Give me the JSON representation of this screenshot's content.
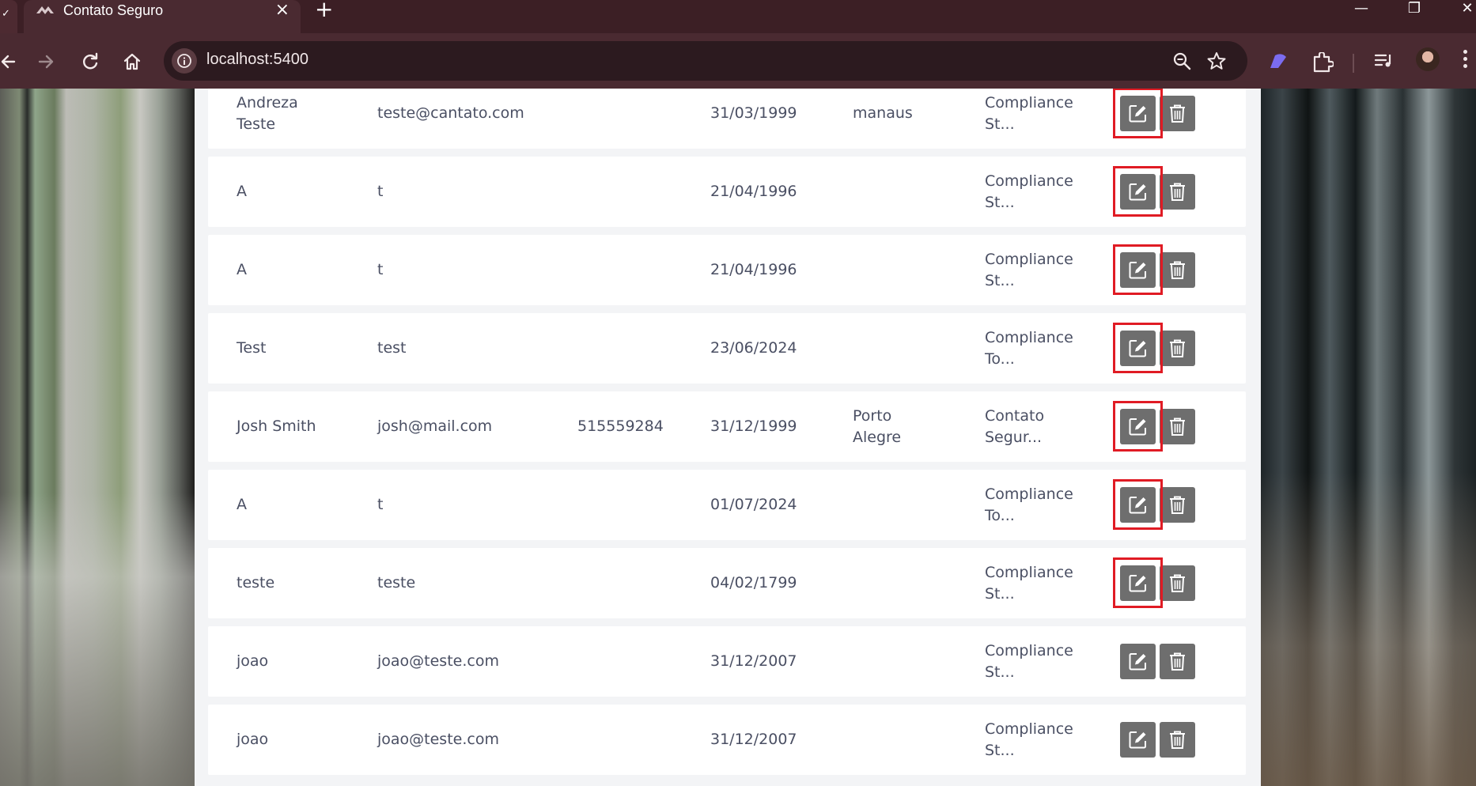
{
  "browser": {
    "tab_title": "Contato Seguro",
    "tab_close": "×",
    "new_tab": "+",
    "url": "localhost:5400",
    "window_controls": {
      "minimize": "—",
      "maximize": "❐",
      "close": "✕"
    }
  },
  "colors": {
    "chrome_dark": "#3c1f25",
    "chrome_toolbar": "#4a2a31",
    "omnibox": "#2c1a1f",
    "panel_bg": "#f3f4f6",
    "row_bg": "#ffffff",
    "text": "#4a4f63",
    "action_button": "#6e6e6e",
    "highlight": "#e01b24"
  },
  "icons": {
    "back": "arrow-left-icon",
    "forward": "arrow-right-icon",
    "reload": "reload-icon",
    "home": "home-icon",
    "info": "info-icon",
    "zoom": "zoom-out-icon",
    "bookmark": "star-icon",
    "edit": "pencil-square-icon",
    "delete": "trash-icon"
  },
  "rows": [
    {
      "name": [
        "Andreza",
        "Teste"
      ],
      "email": "teste@cantato.com",
      "phone": "",
      "date": "31/03/1999",
      "city": [
        "manaus"
      ],
      "company": [
        "Compliance",
        "St..."
      ],
      "highlighted": true
    },
    {
      "name": [
        "A"
      ],
      "email": "t",
      "phone": "",
      "date": "21/04/1996",
      "city": [],
      "company": [
        "Compliance",
        "St..."
      ],
      "highlighted": true
    },
    {
      "name": [
        "A"
      ],
      "email": "t",
      "phone": "",
      "date": "21/04/1996",
      "city": [],
      "company": [
        "Compliance",
        "St..."
      ],
      "highlighted": true
    },
    {
      "name": [
        "Test"
      ],
      "email": "test",
      "phone": "",
      "date": "23/06/2024",
      "city": [],
      "company": [
        "Compliance",
        "To..."
      ],
      "highlighted": true
    },
    {
      "name": [
        "Josh Smith"
      ],
      "email": "josh@mail.com",
      "phone": "515559284",
      "date": "31/12/1999",
      "city": [
        "Porto",
        "Alegre"
      ],
      "company": [
        "Contato",
        "Segur..."
      ],
      "highlighted": true
    },
    {
      "name": [
        "A"
      ],
      "email": "t",
      "phone": "",
      "date": "01/07/2024",
      "city": [],
      "company": [
        "Compliance",
        "To..."
      ],
      "highlighted": true
    },
    {
      "name": [
        "teste"
      ],
      "email": "teste",
      "phone": "",
      "date": "04/02/1799",
      "city": [],
      "company": [
        "Compliance",
        "St..."
      ],
      "highlighted": true
    },
    {
      "name": [
        "joao"
      ],
      "email": "joao@teste.com",
      "phone": "",
      "date": "31/12/2007",
      "city": [],
      "company": [
        "Compliance",
        "St..."
      ],
      "highlighted": false
    },
    {
      "name": [
        "joao"
      ],
      "email": "joao@teste.com",
      "phone": "",
      "date": "31/12/2007",
      "city": [],
      "company": [
        "Compliance",
        "St..."
      ],
      "highlighted": false
    }
  ]
}
